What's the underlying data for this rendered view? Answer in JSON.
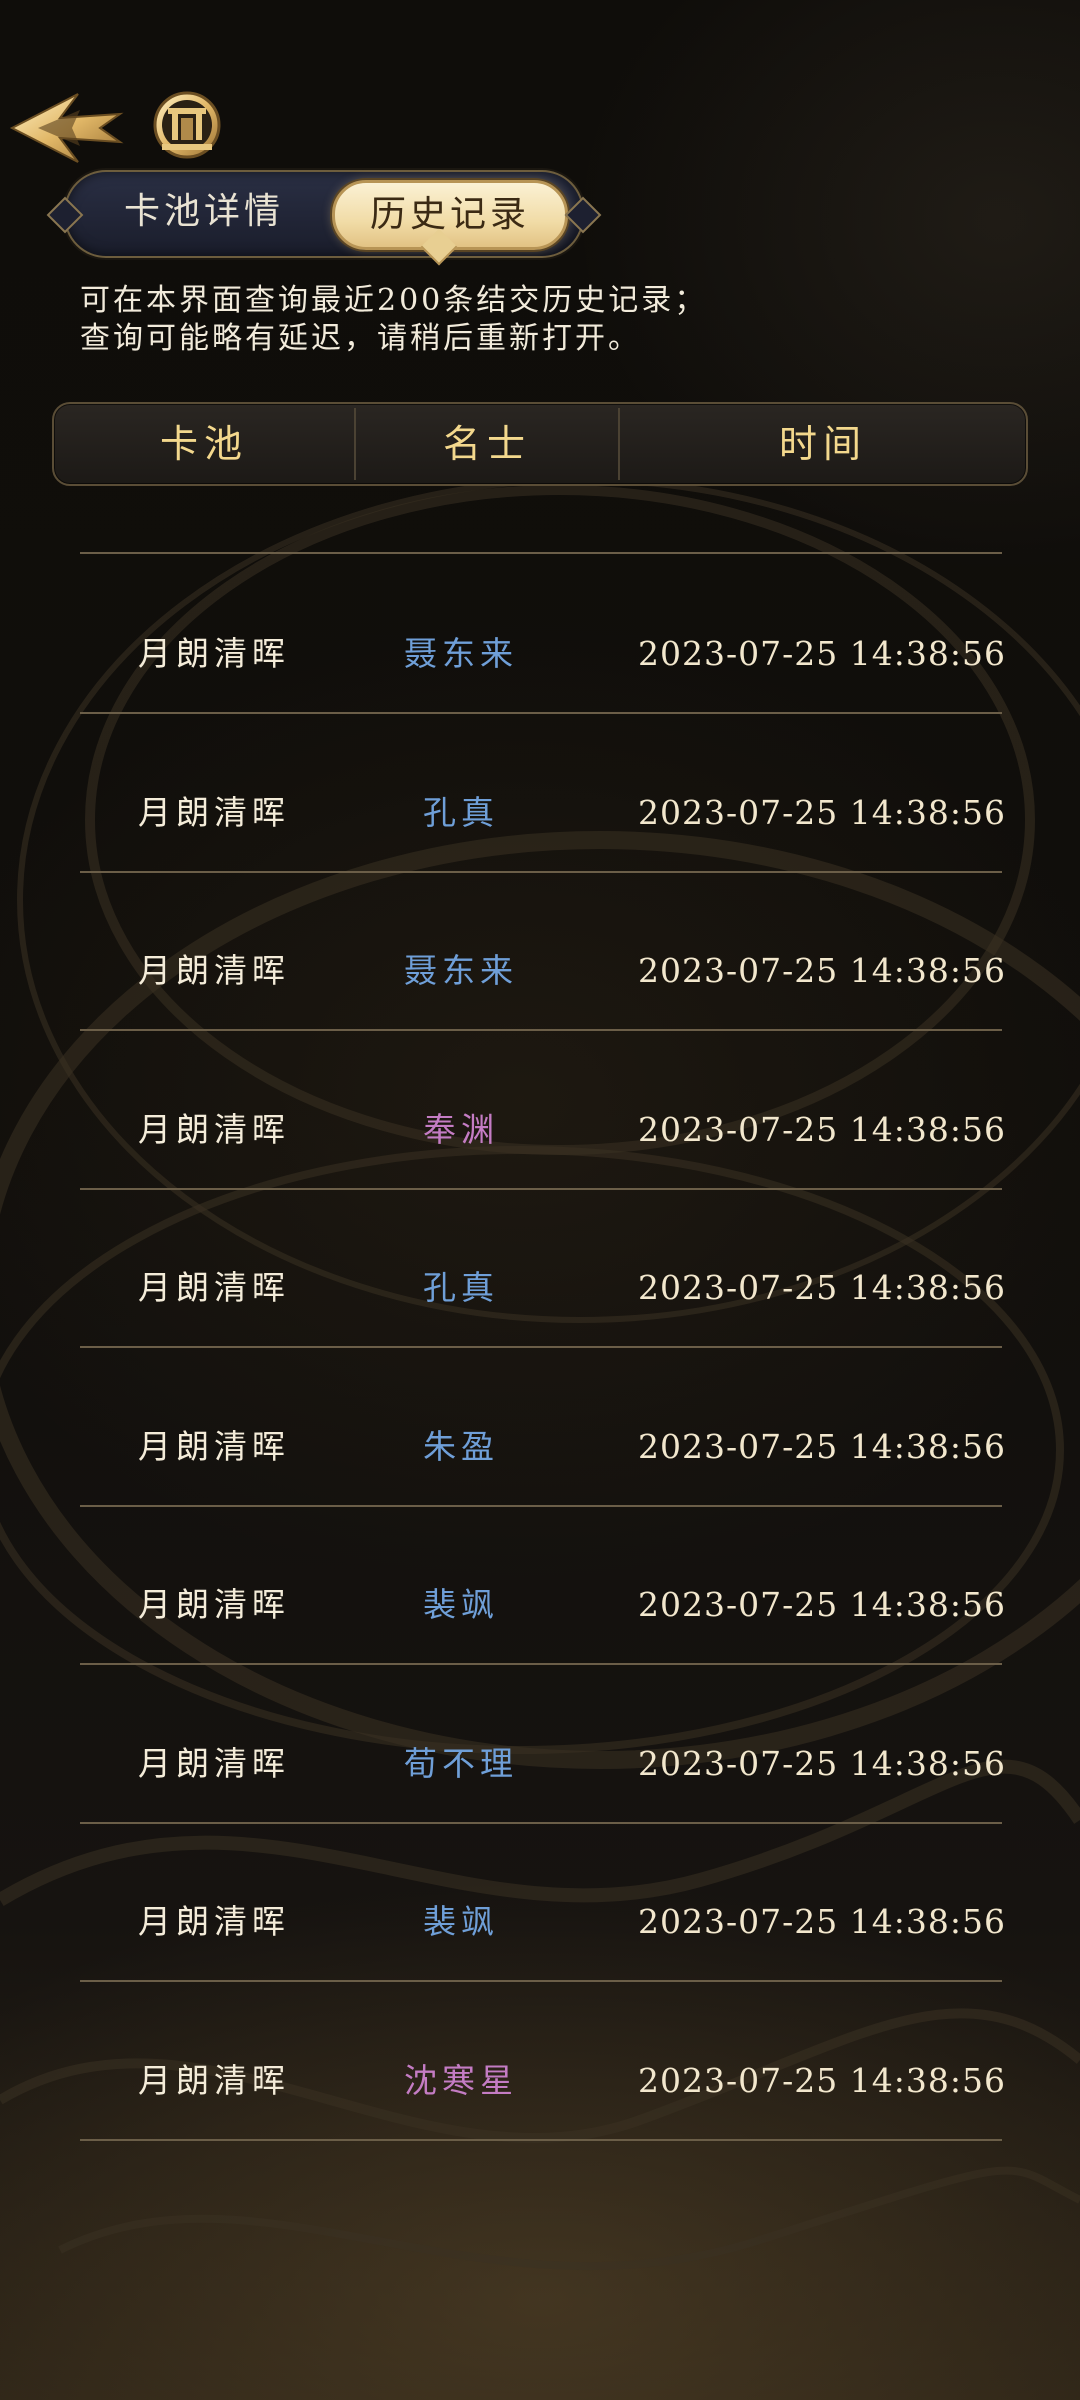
{
  "tabs": {
    "detail": "卡池详情",
    "history": "历史记录"
  },
  "notice": {
    "line1": "可在本界面查询最近200条结交历史记录；",
    "line2": "查询可能略有延迟，请稍后重新打开。"
  },
  "table": {
    "headers": {
      "pool": "卡池",
      "character": "名士",
      "time": "时间"
    },
    "rows": [
      {
        "pool": "月朗清晖",
        "character": "聂东来",
        "time": "2023-07-25 14:38:56",
        "color": "#6f9fd8"
      },
      {
        "pool": "月朗清晖",
        "character": "孔真",
        "time": "2023-07-25 14:38:56",
        "color": "#6f9fd8"
      },
      {
        "pool": "月朗清晖",
        "character": "聂东来",
        "time": "2023-07-25 14:38:56",
        "color": "#6f9fd8"
      },
      {
        "pool": "月朗清晖",
        "character": "奉渊",
        "time": "2023-07-25 14:38:56",
        "color": "#c47cc4"
      },
      {
        "pool": "月朗清晖",
        "character": "孔真",
        "time": "2023-07-25 14:38:56",
        "color": "#6f9fd8"
      },
      {
        "pool": "月朗清晖",
        "character": "朱盈",
        "time": "2023-07-25 14:38:56",
        "color": "#6f9fd8"
      },
      {
        "pool": "月朗清晖",
        "character": "裴飒",
        "time": "2023-07-25 14:38:56",
        "color": "#6f9fd8"
      },
      {
        "pool": "月朗清晖",
        "character": "荀不理",
        "time": "2023-07-25 14:38:56",
        "color": "#6f9fd8"
      },
      {
        "pool": "月朗清晖",
        "character": "裴飒",
        "time": "2023-07-25 14:38:56",
        "color": "#6f9fd8"
      },
      {
        "pool": "月朗清晖",
        "character": "沈寒星",
        "time": "2023-07-25 14:38:56",
        "color": "#c47cc4"
      }
    ]
  },
  "icons": {
    "back": "back-arrow-icon",
    "home": "home-gate-icon"
  }
}
